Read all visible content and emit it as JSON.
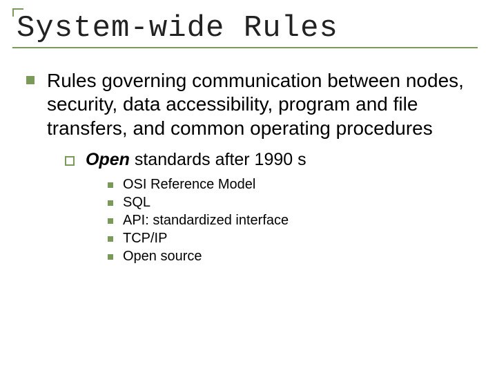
{
  "title": "System-wide Rules",
  "main_point": "Rules governing communication between nodes, security, data accessibility, program and file transfers, and common operating procedures",
  "sub_point": {
    "emph": "Open",
    "rest": " standards after 1990 s"
  },
  "items": [
    "OSI Reference Model",
    "SQL",
    "API: standardized interface",
    "TCP/IP",
    "Open source"
  ],
  "colors": {
    "accent": "#7a9a5a"
  }
}
